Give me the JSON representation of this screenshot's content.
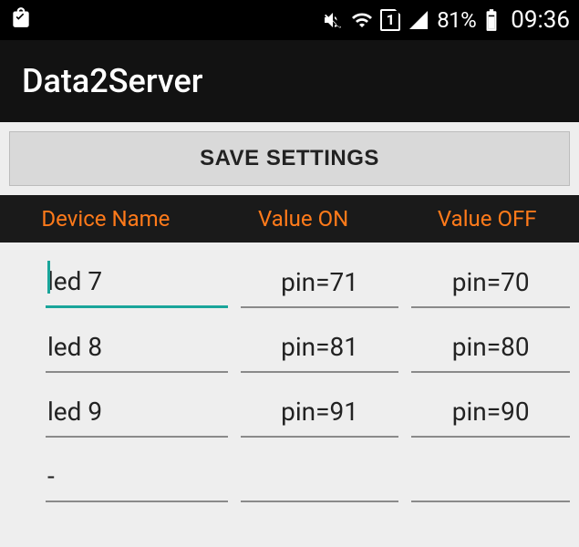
{
  "status": {
    "sim_number": "1",
    "battery_percent": "81%",
    "time": "09:36"
  },
  "app": {
    "title": "Data2Server"
  },
  "buttons": {
    "save": "SAVE SETTINGS"
  },
  "table": {
    "headers": {
      "name": "Device Name",
      "on": "Value ON",
      "off": "Value OFF"
    },
    "rows": [
      {
        "name": "led 7",
        "on": "pin=71",
        "off": "pin=70",
        "focused": true
      },
      {
        "name": "led 8",
        "on": "pin=81",
        "off": "pin=80",
        "focused": false
      },
      {
        "name": "led 9",
        "on": "pin=91",
        "off": "pin=90",
        "focused": false
      },
      {
        "name": "-",
        "on": "",
        "off": "",
        "focused": false
      }
    ]
  }
}
